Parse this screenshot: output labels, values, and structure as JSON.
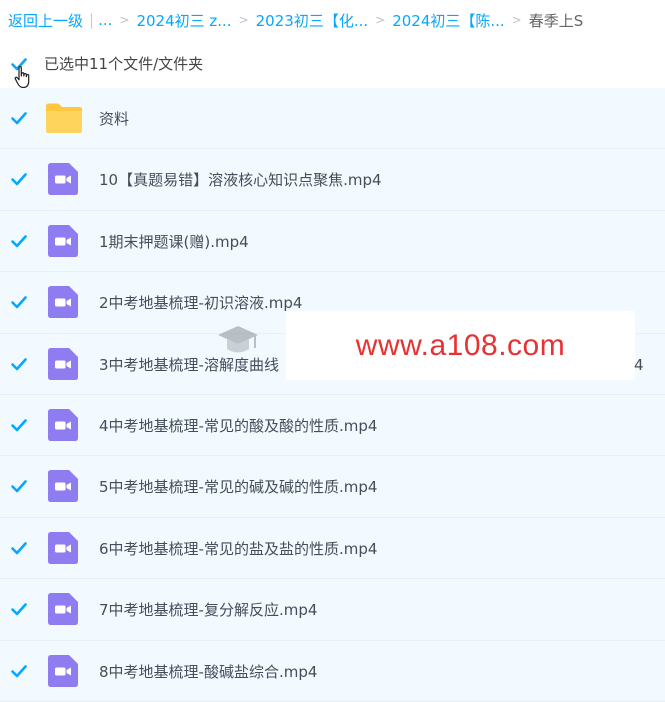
{
  "breadcrumb": {
    "back": "返回上一级",
    "ellipsis": "...",
    "items": [
      "2024初三 z...",
      "2023初三【化...",
      "2024初三【陈..."
    ],
    "current": "春季上S"
  },
  "selection": {
    "label": "已选中11个文件/文件夹"
  },
  "files": [
    {
      "name": "资料",
      "type": "folder"
    },
    {
      "name": "10【真题易错】溶液核心知识点聚焦.mp4",
      "type": "video"
    },
    {
      "name": "1期末押题课(赠).mp4",
      "type": "video"
    },
    {
      "name": "2中考地基梳理-初识溶液.mp4",
      "type": "video"
    },
    {
      "name": "3中考地基梳理-溶解度曲线",
      "type": "video"
    },
    {
      "name": "4中考地基梳理-常见的酸及酸的性质.mp4",
      "type": "video"
    },
    {
      "name": "5中考地基梳理-常见的碱及碱的性质.mp4",
      "type": "video"
    },
    {
      "name": "6中考地基梳理-常见的盐及盐的性质.mp4",
      "type": "video"
    },
    {
      "name": "7中考地基梳理-复分解反应.mp4",
      "type": "video"
    },
    {
      "name": "8中考地基梳理-酸碱盐综合.mp4",
      "type": "video"
    }
  ],
  "watermark": {
    "text": "www.a108.com",
    "trailing": "4"
  },
  "colors": {
    "accent": "#06a7ff",
    "row_bg": "#f2faff",
    "video_icon": "#8e7cf0",
    "folder_icon": "#ffc640",
    "watermark": "#e63232"
  }
}
